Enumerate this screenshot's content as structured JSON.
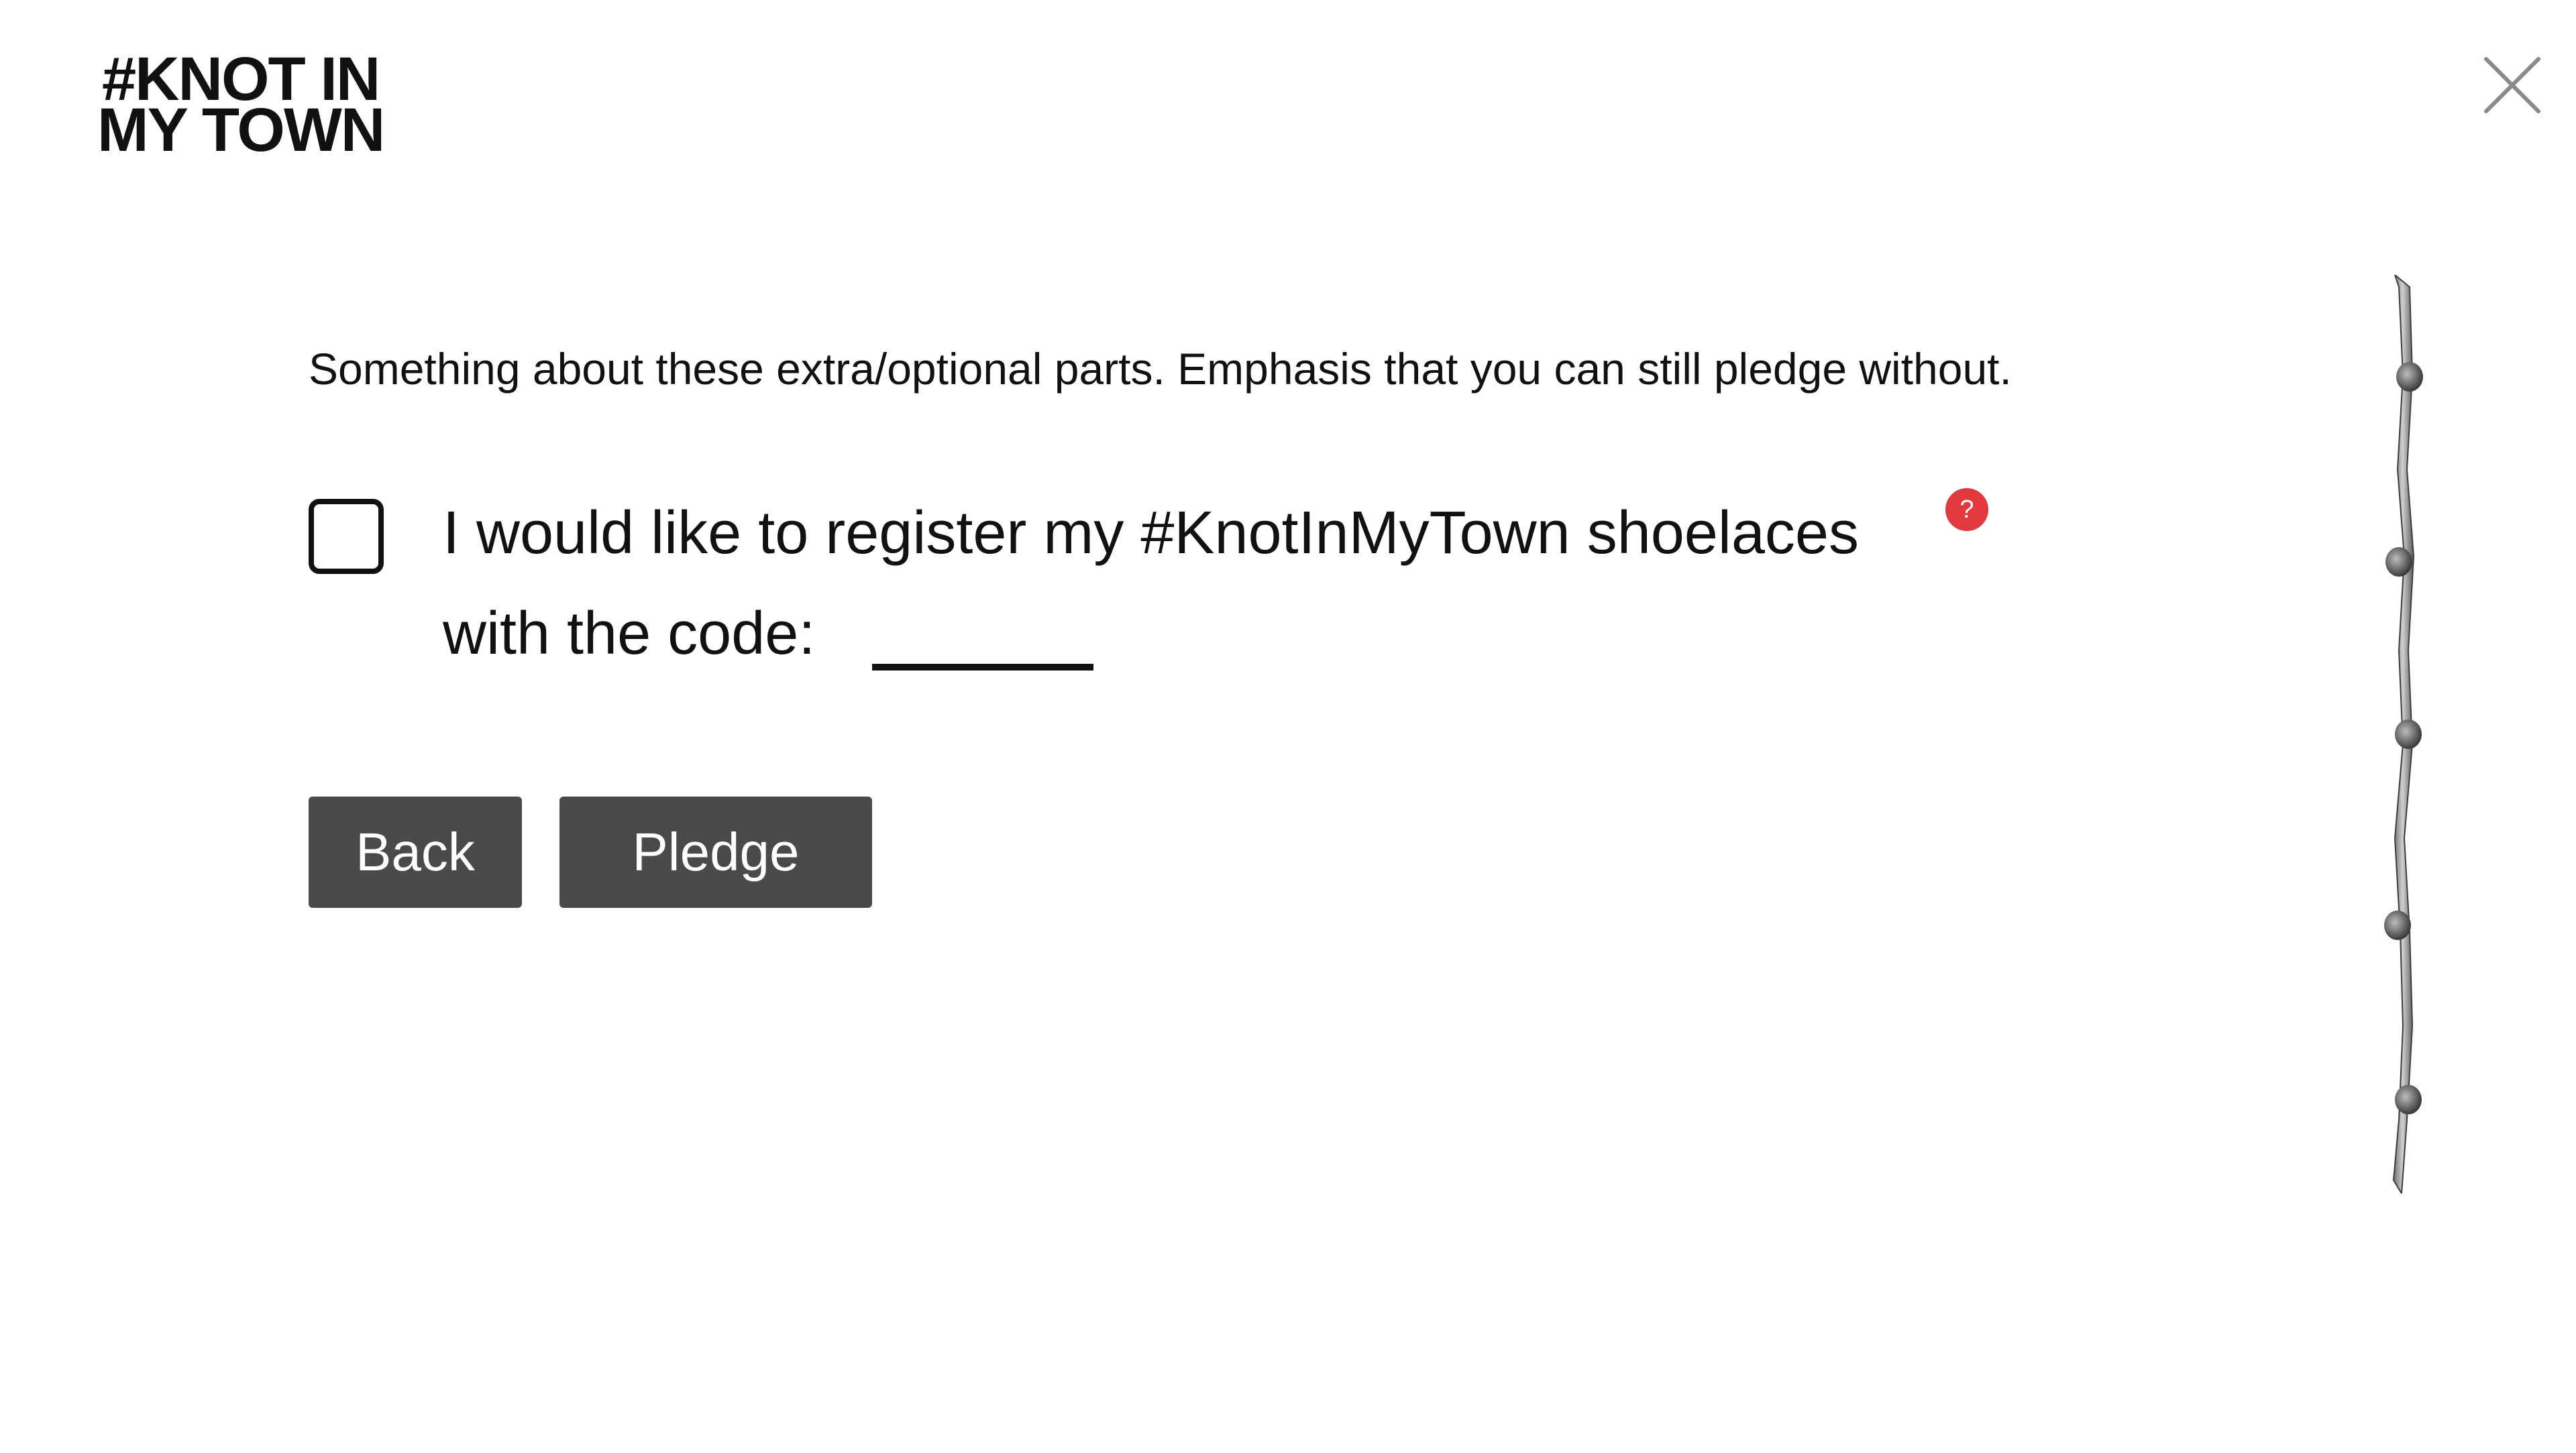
{
  "logo": {
    "line1": "#KNOT IN",
    "line2": "MY TOWN"
  },
  "close": {
    "icon": "close-icon"
  },
  "intro_text": "Something about these extra/optional parts. Emphasis that you can still pledge without.",
  "register": {
    "line1": "I would like to register my #KnotInMyTown shoelaces",
    "line2": "with the code:",
    "checked": false,
    "code_value": "",
    "help_icon": "question-mark-icon",
    "help_label": "?"
  },
  "buttons": {
    "back_label": "Back",
    "pledge_label": "Pledge"
  },
  "colors": {
    "button_bg": "#4a494c",
    "help_badge": "#e0393f",
    "text": "#111111"
  },
  "decoration": {
    "icon": "knotted-shoelace-image"
  }
}
